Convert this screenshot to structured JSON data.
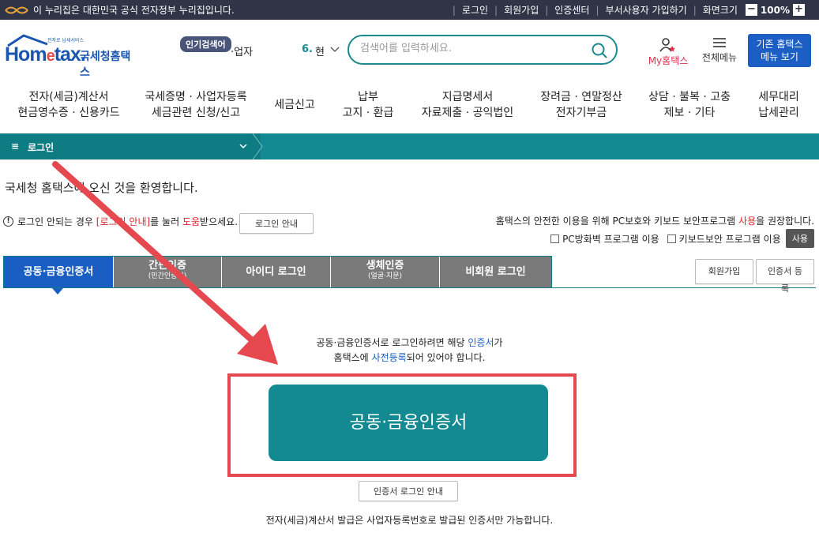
{
  "gov_bar": {
    "notice": "이 누리집은 대한민국 공식 전자정부 누리집입니다.",
    "links": [
      "로그인",
      "회원가입",
      "인증센터",
      "부서사용자 가입하기",
      "화면크기"
    ],
    "zoom_level": "100%",
    "zoom_minus": "−",
    "zoom_plus": "+"
  },
  "header": {
    "logo_small": "전자로 납세서비스",
    "logo_brand_a": "Hom",
    "logo_brand_e": "e",
    "logo_brand_b": "tax.",
    "logo_kr": "국세청홈택스",
    "popular_label": "인기검색어",
    "popular_word": "·업자",
    "popular_rank": "6.",
    "popular_rank_word": "현",
    "search_placeholder": "검색어를 입력하세요.",
    "my_hometax": "My홈택스",
    "all_menu": "전체메뉴",
    "old_view_line1": "기존 홈택스",
    "old_view_line2": "메뉴 보기"
  },
  "gnb": [
    {
      "l1": "전자(세금)계산서",
      "l2": "현금영수증 · 신용카드"
    },
    {
      "l1": "국세증명 · 사업자등록",
      "l2": "세금관련 신청/신고"
    },
    {
      "l1": "세금신고",
      "l2": ""
    },
    {
      "l1": "납부",
      "l2": "고지 · 환급"
    },
    {
      "l1": "지급명세서",
      "l2": "자료제출 · 공익법인"
    },
    {
      "l1": "장려금 · 연말정산",
      "l2": "전자기부금"
    },
    {
      "l1": "상담 · 불복 · 고충",
      "l2": "제보 · 기타"
    },
    {
      "l1": "세무대리",
      "l2": "납세관리"
    }
  ],
  "breadcrumb": {
    "menu_glyph": "≡",
    "label": "로그인"
  },
  "welcome": "국세청 홈택스에 오신 것을 환영합니다.",
  "notice": {
    "pre": "로그인 안되는 경우",
    "link1": "[로그인 안내]",
    "mid": "를 눌러",
    "link2": "도움",
    "post": "받으세요.",
    "button": "로그인 안내"
  },
  "security": {
    "text_pre": "홈택스의 안전한 이용을 위해 PC보호와 키보드 보안프로그램",
    "text_red": "사용",
    "text_post": "을 권장합니다.",
    "opt1": "PC방화벽 프로그램 이용",
    "opt2": "키보드보안 프로그램 이용",
    "button": "사용"
  },
  "tabs": [
    {
      "label": "공동·금융인증서",
      "sub": ""
    },
    {
      "label": "간편인증",
      "sub": "(민간인증서)"
    },
    {
      "label": "아이디 로그인",
      "sub": ""
    },
    {
      "label": "생체인증",
      "sub": "(얼굴·지문)"
    },
    {
      "label": "비회원 로그인",
      "sub": ""
    }
  ],
  "side_buttons": {
    "join": "회원가입",
    "cert_reg": "인증서 등록"
  },
  "content": {
    "line1_pre": "공동·금융인증서로 로그인하려면 해당",
    "line1_blue": "인증서",
    "line1_post": "가",
    "line2_pre": "홈택스에",
    "line2_blue": "사전등록",
    "line2_post": "되어 있어야 합니다.",
    "cert_button": "공동·금융인증서",
    "cert_guide": "인증서 로그인 안내",
    "footer_note": "전자(세금)계산서 발급은 사업자등록번호로 발급된 인증서만 가능합니다."
  },
  "colors": {
    "teal": "#138a91",
    "blue": "#1a5ec4",
    "highlight_red": "#e5494f",
    "gov_bar": "#2f3547"
  }
}
